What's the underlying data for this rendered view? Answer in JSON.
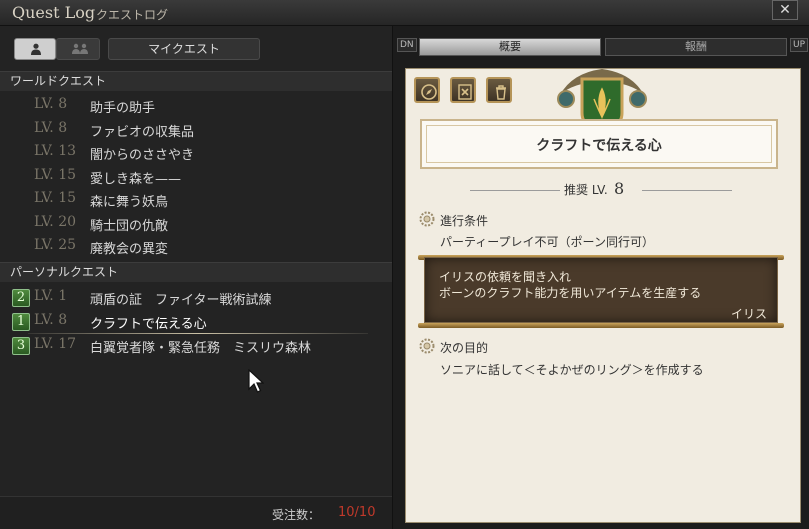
{
  "window": {
    "title": "Quest Log",
    "subtitle": "クエストログ",
    "close_label": "✕"
  },
  "left": {
    "my_quest_label": "マイクエスト",
    "sections": [
      {
        "title": "ワールドクエスト",
        "quests": [
          {
            "level": "LV. 8",
            "name": "助手の助手"
          },
          {
            "level": "LV. 8",
            "name": "ファビオの収集品"
          },
          {
            "level": "LV. 13",
            "name": "闇からのささやき"
          },
          {
            "level": "LV. 15",
            "name": "愛しき森を——"
          },
          {
            "level": "LV. 15",
            "name": "森に舞う妖鳥"
          },
          {
            "level": "LV. 20",
            "name": "騎士団の仇敵"
          },
          {
            "level": "LV. 25",
            "name": "廃教会の異変"
          }
        ]
      },
      {
        "title": "パーソナルクエスト",
        "quests": [
          {
            "badge": "2",
            "level": "LV. 1",
            "name": "頑盾の証　ファイター戦術試練"
          },
          {
            "badge": "1",
            "level": "LV. 8",
            "name": "クラフトで伝える心",
            "selected": true
          },
          {
            "badge": "3",
            "level": "LV. 17",
            "name": "白翼覚者隊・緊急任務　ミスリウ森林"
          }
        ]
      }
    ],
    "footer": {
      "label": "受注数：",
      "count": "10/10"
    }
  },
  "right": {
    "dn_label": "DN",
    "up_label": "UP",
    "tabs": [
      "概要",
      "報酬"
    ],
    "quest_title": "クラフトで伝える心",
    "recommended_label": "推奨 LV.",
    "recommended_level": "8",
    "conditions_label": "進行条件",
    "conditions_text": "パーティープレイ不可（ポーン同行可）",
    "description_lines": [
      "イリスの依頼を聞き入れ",
      "ボーンのクラフト能力を用いアイテムを生産する"
    ],
    "description_npc": "イリス",
    "next_label": "次の目的",
    "next_text": "ソニアに話して＜そよかぜのリング＞を作成する"
  },
  "colors": {
    "badge_green": "#4f8a3e",
    "count_red": "#c0392b",
    "parchment": "#f1ece1"
  }
}
